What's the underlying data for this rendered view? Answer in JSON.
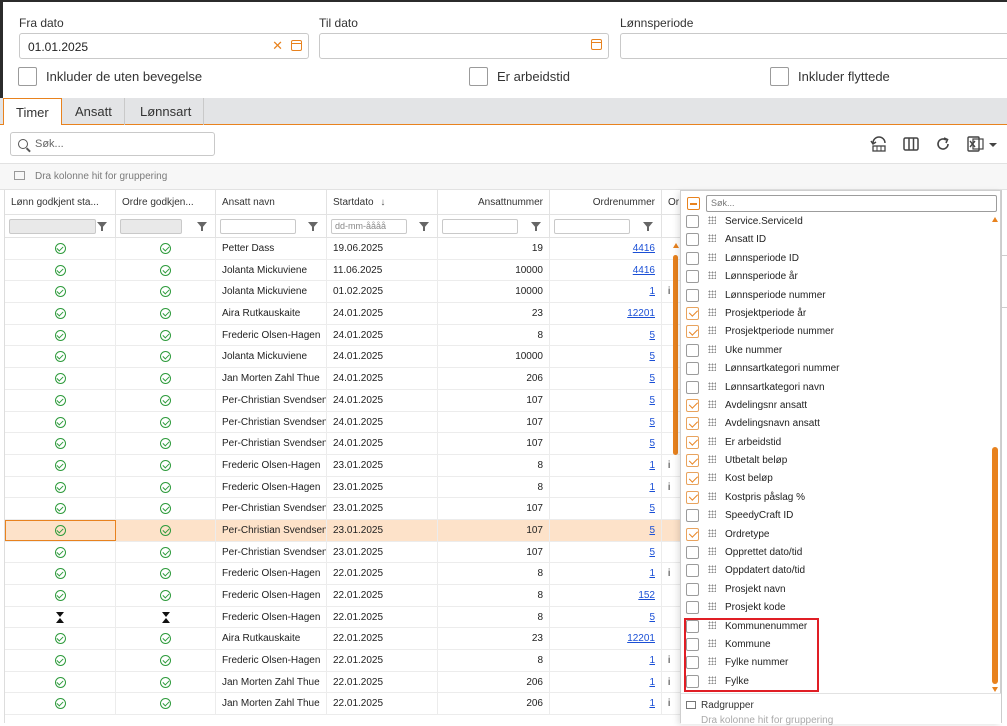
{
  "filters": {
    "fra_label": "Fra dato",
    "fra_value": "01.01.2025",
    "til_label": "Til dato",
    "til_value": "",
    "lonn_label": "Lønnsperiode",
    "lonn_value": "",
    "chk_uten": "Inkluder de uten bevegelse",
    "chk_arbeid": "Er arbeidstid",
    "chk_flytt": "Inkluder flyttede"
  },
  "tabs": [
    "Timer",
    "Ansatt",
    "Lønnsart"
  ],
  "toolbar": {
    "search_placeholder": "Søk..."
  },
  "groupbar": {
    "hint": "Dra kolonne hit for gruppering"
  },
  "grid": {
    "headers": [
      "Lønn godkjent sta...",
      "Ordre godkjen...",
      "Ansatt navn",
      "Startdato",
      "Ansattnummer",
      "Ordrenummer",
      "Or"
    ],
    "sort_glyph": "↓",
    "date_filter_placeholder": "dd-mm-åååå",
    "rows": [
      {
        "l": "ok",
        "o": "ok",
        "name": "Petter Dass",
        "date": "19.06.2025",
        "ans": "19",
        "ord": "4416",
        "t": ""
      },
      {
        "l": "ok",
        "o": "ok",
        "name": "Jolanta Mickuviene",
        "date": "11.06.2025",
        "ans": "10000",
        "ord": "4416",
        "t": ""
      },
      {
        "l": "ok",
        "o": "ok",
        "name": "Jolanta Mickuviene",
        "date": "01.02.2025",
        "ans": "10000",
        "ord": "1",
        "t": "i"
      },
      {
        "l": "ok",
        "o": "ok",
        "name": "Aira Rutkauskaite",
        "date": "24.01.2025",
        "ans": "23",
        "ord": "12201",
        "t": ""
      },
      {
        "l": "ok",
        "o": "ok",
        "name": "Frederic Olsen-Hagen",
        "date": "24.01.2025",
        "ans": "8",
        "ord": "5",
        "t": ""
      },
      {
        "l": "ok",
        "o": "ok",
        "name": "Jolanta Mickuviene",
        "date": "24.01.2025",
        "ans": "10000",
        "ord": "5",
        "t": ""
      },
      {
        "l": "ok",
        "o": "ok",
        "name": "Jan Morten Zahl Thue",
        "date": "24.01.2025",
        "ans": "206",
        "ord": "5",
        "t": ""
      },
      {
        "l": "ok",
        "o": "ok",
        "name": "Per-Christian Svendsen",
        "date": "24.01.2025",
        "ans": "107",
        "ord": "5",
        "t": ""
      },
      {
        "l": "ok",
        "o": "ok",
        "name": "Per-Christian Svendsen",
        "date": "24.01.2025",
        "ans": "107",
        "ord": "5",
        "t": ""
      },
      {
        "l": "ok",
        "o": "ok",
        "name": "Per-Christian Svendsen",
        "date": "24.01.2025",
        "ans": "107",
        "ord": "5",
        "t": ""
      },
      {
        "l": "ok",
        "o": "ok",
        "name": "Frederic Olsen-Hagen",
        "date": "23.01.2025",
        "ans": "8",
        "ord": "1",
        "t": "i"
      },
      {
        "l": "ok",
        "o": "ok",
        "name": "Frederic Olsen-Hagen",
        "date": "23.01.2025",
        "ans": "8",
        "ord": "1",
        "t": "i"
      },
      {
        "l": "ok",
        "o": "ok",
        "name": "Per-Christian Svendsen",
        "date": "23.01.2025",
        "ans": "107",
        "ord": "5",
        "t": ""
      },
      {
        "l": "ok",
        "o": "ok",
        "name": "Per-Christian Svendsen",
        "date": "23.01.2025",
        "ans": "107",
        "ord": "5",
        "t": "",
        "sel": true
      },
      {
        "l": "ok",
        "o": "ok",
        "name": "Per-Christian Svendsen",
        "date": "23.01.2025",
        "ans": "107",
        "ord": "5",
        "t": ""
      },
      {
        "l": "ok",
        "o": "ok",
        "name": "Frederic Olsen-Hagen",
        "date": "22.01.2025",
        "ans": "8",
        "ord": "1",
        "t": "i"
      },
      {
        "l": "ok",
        "o": "ok",
        "name": "Frederic Olsen-Hagen",
        "date": "22.01.2025",
        "ans": "8",
        "ord": "152",
        "t": ""
      },
      {
        "l": "hg",
        "o": "hg",
        "name": "Frederic Olsen-Hagen",
        "date": "22.01.2025",
        "ans": "8",
        "ord": "5",
        "t": ""
      },
      {
        "l": "ok",
        "o": "ok",
        "name": "Aira Rutkauskaite",
        "date": "22.01.2025",
        "ans": "23",
        "ord": "12201",
        "t": ""
      },
      {
        "l": "ok",
        "o": "ok",
        "name": "Frederic Olsen-Hagen",
        "date": "22.01.2025",
        "ans": "8",
        "ord": "1",
        "t": "i"
      },
      {
        "l": "ok",
        "o": "ok",
        "name": "Jan Morten Zahl Thue",
        "date": "22.01.2025",
        "ans": "206",
        "ord": "1",
        "t": "i"
      },
      {
        "l": "ok",
        "o": "ok",
        "name": "Jan Morten Zahl Thue",
        "date": "22.01.2025",
        "ans": "206",
        "ord": "1",
        "t": "i"
      }
    ]
  },
  "chooser": {
    "search_placeholder": "Søk...",
    "items": [
      {
        "label": "Service.ServiceId",
        "checked": false
      },
      {
        "label": "Ansatt ID",
        "checked": false
      },
      {
        "label": "Lønnsperiode ID",
        "checked": false
      },
      {
        "label": "Lønnsperiode år",
        "checked": false
      },
      {
        "label": "Lønnsperiode nummer",
        "checked": false
      },
      {
        "label": "Prosjektperiode år",
        "checked": true
      },
      {
        "label": "Prosjektperiode nummer",
        "checked": true
      },
      {
        "label": "Uke nummer",
        "checked": false
      },
      {
        "label": "Lønnsartkategori nummer",
        "checked": false
      },
      {
        "label": "Lønnsartkategori navn",
        "checked": false
      },
      {
        "label": "Avdelingsnr ansatt",
        "checked": true
      },
      {
        "label": "Avdelingsnavn ansatt",
        "checked": true
      },
      {
        "label": "Er arbeidstid",
        "checked": true
      },
      {
        "label": "Utbetalt beløp",
        "checked": true
      },
      {
        "label": "Kost beløp",
        "checked": true
      },
      {
        "label": "Kostpris påslag %",
        "checked": true
      },
      {
        "label": "SpeedyCraft ID",
        "checked": false
      },
      {
        "label": "Ordretype",
        "checked": true
      },
      {
        "label": "Opprettet dato/tid",
        "checked": false
      },
      {
        "label": "Oppdatert dato/tid",
        "checked": false
      },
      {
        "label": "Prosjekt navn",
        "checked": false
      },
      {
        "label": "Prosjekt kode",
        "checked": false
      },
      {
        "label": "Kommunenummer",
        "checked": false
      },
      {
        "label": "Kommune",
        "checked": false
      },
      {
        "label": "Fylke nummer",
        "checked": false
      },
      {
        "label": "Fylke",
        "checked": false
      }
    ],
    "footer_label": "Radgrupper",
    "footer_hint": "Dra kolonne hit for gruppering"
  },
  "colors": {
    "accent": "#e8821e",
    "ok": "#2e9b3c",
    "link": "#1a4fd6",
    "highlight": "#e01e25",
    "selected_row": "#fde2c9"
  }
}
